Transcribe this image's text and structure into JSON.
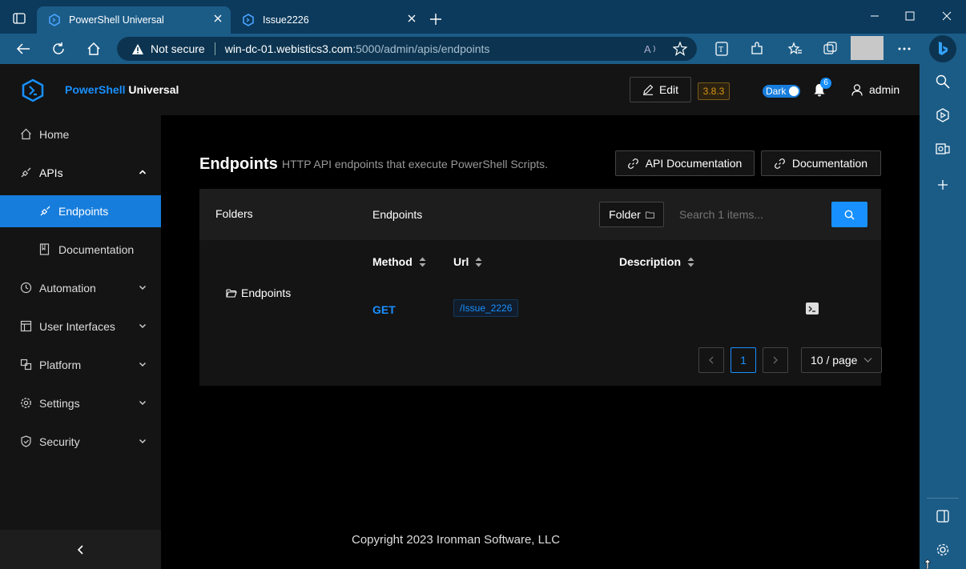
{
  "browser": {
    "tabs": [
      {
        "title": "PowerShell Universal",
        "active": true
      },
      {
        "title": "Issue2226",
        "active": false
      }
    ],
    "address": {
      "security_label": "Not secure",
      "url_host": "win-dc-01.webistics3.com",
      "url_path": ":5000/admin/apis/endpoints"
    }
  },
  "app": {
    "brand_bold": "PowerShell",
    "brand_rest": " Universal",
    "edit_label": "Edit",
    "version": "3.8.3",
    "theme_label": "Dark",
    "notification_count": "6",
    "user": "admin"
  },
  "sidebar": {
    "items": [
      {
        "label": "Home",
        "icon": "home-icon"
      },
      {
        "label": "APIs",
        "icon": "api-icon",
        "expanded": true
      },
      {
        "label": "Endpoints",
        "icon": "api-icon",
        "sub": true,
        "selected": true
      },
      {
        "label": "Documentation",
        "icon": "document-icon",
        "sub": true
      },
      {
        "label": "Automation",
        "icon": "clock-icon"
      },
      {
        "label": "User Interfaces",
        "icon": "layout-icon"
      },
      {
        "label": "Platform",
        "icon": "platform-icon"
      },
      {
        "label": "Settings",
        "icon": "gear-icon"
      },
      {
        "label": "Security",
        "icon": "shield-icon"
      }
    ],
    "collapse_icon": "chevron-left-icon"
  },
  "page": {
    "title": "Endpoints",
    "subtitle": "HTTP API endpoints that execute PowerShell Scripts.",
    "api_docs_button": "API Documentation",
    "docs_button": "Documentation",
    "folders_header": "Folders",
    "endpoints_header": "Endpoints",
    "folder_button": "Folder",
    "search_placeholder": "Search 1 items...",
    "folder_tree_item": "Endpoints",
    "columns": [
      "Method",
      "Url",
      "Description"
    ],
    "rows": [
      {
        "method": "GET",
        "url": "/Issue_2226",
        "description": ""
      }
    ],
    "pagination": {
      "current": "1",
      "page_size": "10 / page"
    },
    "footer": "Copyright 2023 Ironman Software, LLC"
  },
  "colors": {
    "accent": "#1890ff",
    "selected_nav": "#177ddc",
    "version_badge": "#d89614"
  }
}
